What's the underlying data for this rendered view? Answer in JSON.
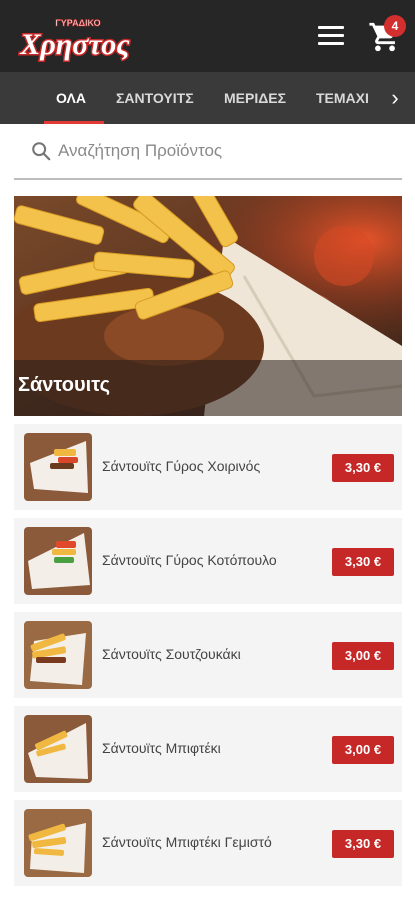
{
  "header": {
    "logo_small": "ΓΥΡΑΔΙΚΟ",
    "logo_main": "Χρηστος",
    "menu_icon": "hamburger-menu-icon",
    "cart_icon": "shopping-cart-icon",
    "cart_count": "4"
  },
  "tabs": {
    "items": [
      {
        "label": "ΟΛΑ",
        "active": true
      },
      {
        "label": "ΣΑΝΤΟΥΙΤΣ",
        "active": false
      },
      {
        "label": "ΜΕΡΙΔΕΣ",
        "active": false
      },
      {
        "label": "ΤΕΜΑΧΙ",
        "active": false
      }
    ],
    "more_icon": "chevron-right-icon"
  },
  "search": {
    "placeholder": "Αναζήτηση Προϊόντος",
    "value": ""
  },
  "hero": {
    "title": "Σάντουιτς"
  },
  "products": [
    {
      "name": "Σάντουϊτς Γύρος Χοιρινός",
      "price": "3,30 €"
    },
    {
      "name": "Σάντουϊτς Γύρος Κοτόπουλο",
      "price": "3,30 €"
    },
    {
      "name": "Σάντουϊτς Σουτζουκάκι",
      "price": "3,00 €"
    },
    {
      "name": "Σάντουϊτς Μπιφτέκι",
      "price": "3,00 €"
    },
    {
      "name": "Σάντουϊτς Μπιφτέκι Γεμιστό",
      "price": "3,30 €"
    }
  ],
  "colors": {
    "header_bg": "#262626",
    "tabs_bg": "#3a3a3a",
    "accent_red": "#c62828",
    "badge_red": "#d32f2f"
  }
}
